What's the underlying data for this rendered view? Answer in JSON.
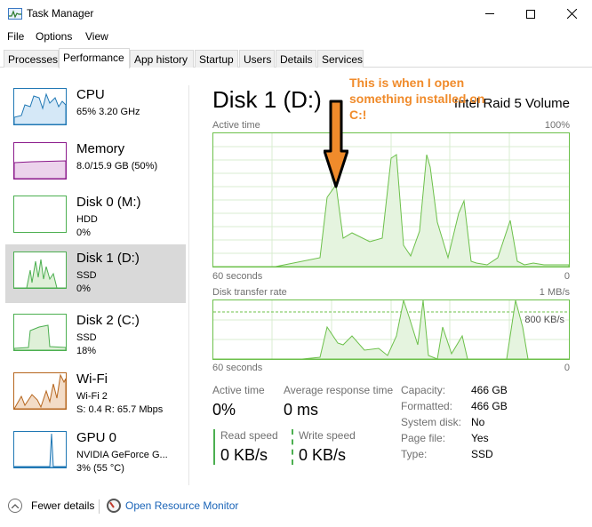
{
  "window": {
    "title": "Task Manager"
  },
  "menu": [
    "File",
    "Options",
    "View"
  ],
  "tabs": [
    "Processes",
    "Performance",
    "App history",
    "Startup",
    "Users",
    "Details",
    "Services"
  ],
  "active_tab": "Performance",
  "resources": [
    {
      "name": "CPU",
      "line1": "65% 3.20 GHz",
      "line2": "",
      "color": "#1f77b4"
    },
    {
      "name": "Memory",
      "line1": "8.0/15.9 GB (50%)",
      "line2": "",
      "color": "#8b1a8b"
    },
    {
      "name": "Disk 0 (M:)",
      "line1": "HDD",
      "line2": "0%",
      "color": "#4caf50"
    },
    {
      "name": "Disk 1 (D:)",
      "line1": "SSD",
      "line2": "0%",
      "color": "#4caf50"
    },
    {
      "name": "Disk 2 (C:)",
      "line1": "SSD",
      "line2": "18%",
      "color": "#4caf50"
    },
    {
      "name": "Wi-Fi",
      "line1": "Wi-Fi 2",
      "line2": "S: 0.4 R: 65.7 Mbps",
      "color": "#b5651d"
    },
    {
      "name": "GPU 0",
      "line1": "NVIDIA GeForce G...",
      "line2": "3% (55 °C)",
      "color": "#1f77b4"
    }
  ],
  "detail": {
    "title": "Disk 1 (D:)",
    "model": "Intel Raid 5 Volume",
    "annotation": "This is when I open something installed on C:!",
    "graph1": {
      "label": "Active time",
      "max": "100%",
      "xleft": "60 seconds",
      "xright": "0"
    },
    "graph2": {
      "label": "Disk transfer rate",
      "max": "1 MB/s",
      "inner": "800 KB/s",
      "xleft": "60 seconds",
      "xright": "0"
    },
    "stats": {
      "active_time_label": "Active time",
      "active_time_value": "0%",
      "avg_resp_label": "Average response time",
      "avg_resp_value": "0 ms",
      "read_label": "Read speed",
      "read_value": "0 KB/s",
      "write_label": "Write speed",
      "write_value": "0 KB/s"
    },
    "props": [
      {
        "k": "Capacity:",
        "v": "466 GB"
      },
      {
        "k": "Formatted:",
        "v": "466 GB"
      },
      {
        "k": "System disk:",
        "v": "No"
      },
      {
        "k": "Page file:",
        "v": "Yes"
      },
      {
        "k": "Type:",
        "v": "SSD"
      }
    ]
  },
  "bottom": {
    "fewer": "Fewer details",
    "monitor": "Open Resource Monitor"
  },
  "graph_color": "#4caf50"
}
